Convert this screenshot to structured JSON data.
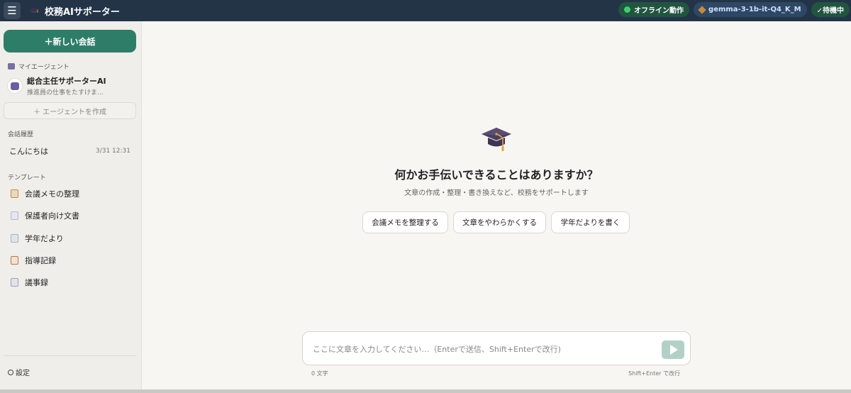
{
  "header": {
    "title": "校務AIサポーター",
    "menu_icon": "hamburger-icon",
    "app_icon": "graduation-cap-icon",
    "offline_label": "オフライン動作",
    "model_label": "gemma-3-1b-it-Q4_K_M",
    "status_label": "✓待機中",
    "colors": {
      "bar": "#243447",
      "accent": "#2e7d68",
      "online_dot": "#3ccf72"
    }
  },
  "sidebar": {
    "new_chat_label": "＋新しい会話",
    "my_agents_label": "マイエージェント",
    "agent": {
      "name": "総合主任サポーターAI",
      "desc": "推進員の仕事をたすけま…",
      "icon": "robot-icon"
    },
    "create_agent_label": "＋ エージェントを作成",
    "history_label": "会話履歴",
    "history": [
      {
        "title": "こんにちは",
        "time": "3/31 12:31"
      }
    ],
    "templates_label": "テンプレート",
    "templates": [
      {
        "label": "会議メモの整理",
        "icon": "memo-icon"
      },
      {
        "label": "保護者向け文書",
        "icon": "document-icon"
      },
      {
        "label": "学年だより",
        "icon": "newspaper-icon"
      },
      {
        "label": "指導記録",
        "icon": "clipboard-icon"
      },
      {
        "label": "議事録",
        "icon": "notebook-icon"
      }
    ],
    "settings_label": "設定"
  },
  "main": {
    "hero_icon": "graduation-cap-icon",
    "title": "何かお手伝いできることはありますか？",
    "subtitle": "文章の作成・整理・書き換えなど、校務をサポートします",
    "suggestions": [
      "会議メモを整理する",
      "文章をやわらかくする",
      "学年だよりを書く"
    ],
    "input_placeholder": "ここに文章を入力してください…（Enterで送信、Shift+Enterで改行)",
    "input_value": "",
    "char_count": "0 文字",
    "hint": "Shift+Enter で改行",
    "send_icon": "send-icon"
  }
}
